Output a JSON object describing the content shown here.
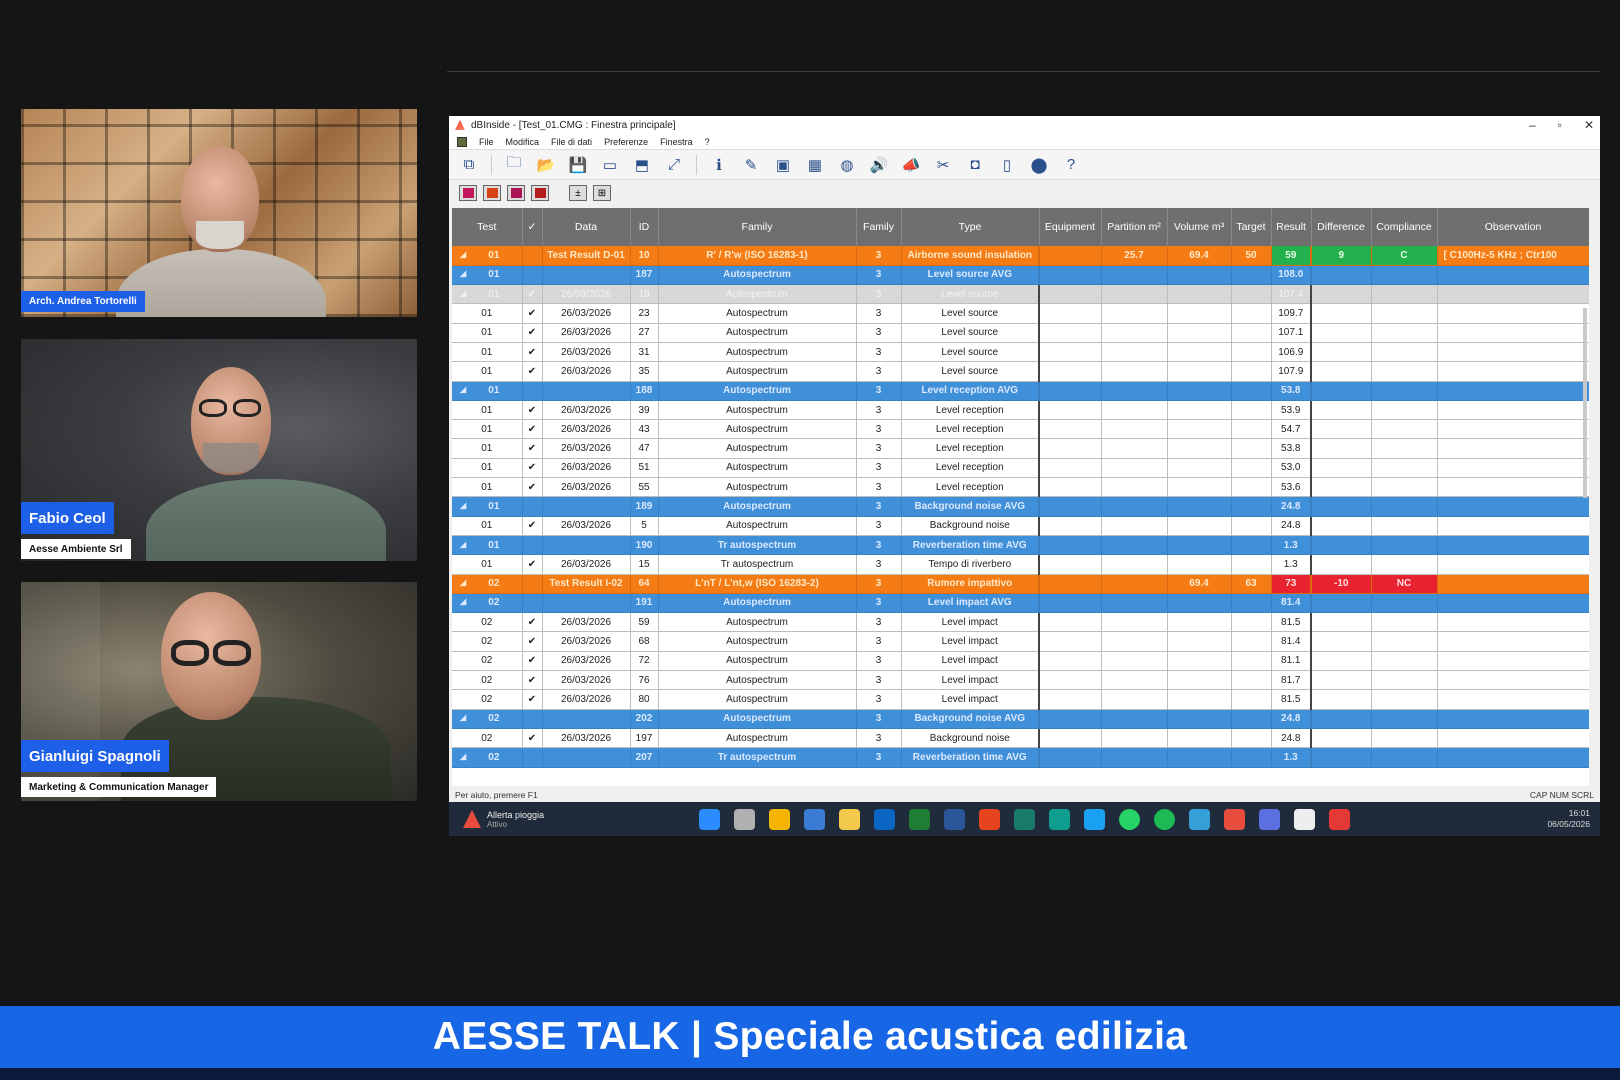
{
  "participants": [
    {
      "name": "Arch. Andrea Tortorelli",
      "subtitle": ""
    },
    {
      "name": "Fabio Ceol",
      "subtitle": "Aesse Ambiente Srl"
    },
    {
      "name": "Gianluigi Spagnoli",
      "subtitle": "Marketing & Communication Manager"
    }
  ],
  "app": {
    "title": "dBInside - [Test_01.CMG : Finestra principale]",
    "menu": [
      "File",
      "Modifica",
      "File di dati",
      "Preferenze",
      "Finestra",
      "?"
    ],
    "window_buttons": [
      "–",
      "▫",
      "✕"
    ],
    "toolbar_icons": [
      "copy-icon",
      "new-folder-icon",
      "open-folder-icon",
      "save-icon",
      "print-preview-icon",
      "tag-icon",
      "link-icon",
      "info-icon",
      "pencil-icon",
      "image-icon",
      "grid-icon",
      "globe-icon",
      "speaker-icon",
      "megaphone-icon",
      "scissors-icon",
      "camera-icon",
      "page-icon",
      "trash-icon",
      "help-icon"
    ],
    "toolbar_glyphs": [
      "⧉",
      "🗀",
      "📂",
      "💾",
      "▭",
      "⬒",
      "⤢",
      "ℹ",
      "✎",
      "▣",
      "▦",
      "◍",
      "🔊",
      "📣",
      "✂",
      "◘",
      "▯",
      "⬤",
      "?"
    ],
    "secondary_toolbar_colors": [
      "#c2185b",
      "#d84315",
      "#ad1457",
      "#b71c1c"
    ],
    "columns": [
      "Test",
      "✓",
      "Data",
      "ID",
      "Family",
      "Family",
      "Type",
      "Equipment",
      "Partition m²",
      "Volume m³",
      "Target",
      "Result",
      "Difference",
      "Compliance",
      "Observation"
    ],
    "rows": [
      {
        "kind": "orange",
        "expand": "◢",
        "test": "01",
        "check": "",
        "date": "Test Result D-01",
        "id": "10",
        "family": "R' / R'w (ISO 16283-1)",
        "fam": "3",
        "type": "Airborne sound insulation",
        "equipment": "",
        "partition": "25.7",
        "volume": "69.4",
        "target": "50",
        "result": "59",
        "difference": "9",
        "compliance": "C",
        "observation": "[ C100Hz-5 KHz ; Ctr100",
        "green": true
      },
      {
        "kind": "blue",
        "expand": "◢",
        "test": "01",
        "check": "",
        "date": "",
        "id": "187",
        "family": "Autospectrum",
        "fam": "3",
        "type": "Level source AVG",
        "result": "108.0"
      },
      {
        "kind": "gray",
        "expand": "◢",
        "test": "01",
        "check": "✔",
        "date": "26/03/2026",
        "id": "19",
        "family": "Autospectrum",
        "fam": "3",
        "type": "Level source",
        "result": "107.4"
      },
      {
        "kind": "white",
        "test": "01",
        "check": "✔",
        "date": "26/03/2026",
        "id": "23",
        "family": "Autospectrum",
        "fam": "3",
        "type": "Level source",
        "result": "109.7"
      },
      {
        "kind": "white",
        "test": "01",
        "check": "✔",
        "date": "26/03/2026",
        "id": "27",
        "family": "Autospectrum",
        "fam": "3",
        "type": "Level source",
        "result": "107.1"
      },
      {
        "kind": "white",
        "test": "01",
        "check": "✔",
        "date": "26/03/2026",
        "id": "31",
        "family": "Autospectrum",
        "fam": "3",
        "type": "Level source",
        "result": "106.9"
      },
      {
        "kind": "white",
        "test": "01",
        "check": "✔",
        "date": "26/03/2026",
        "id": "35",
        "family": "Autospectrum",
        "fam": "3",
        "type": "Level source",
        "result": "107.9"
      },
      {
        "kind": "blue",
        "expand": "◢",
        "test": "01",
        "check": "",
        "date": "",
        "id": "188",
        "family": "Autospectrum",
        "fam": "3",
        "type": "Level reception AVG",
        "result": "53.8"
      },
      {
        "kind": "white",
        "test": "01",
        "check": "✔",
        "date": "26/03/2026",
        "id": "39",
        "family": "Autospectrum",
        "fam": "3",
        "type": "Level reception",
        "result": "53.9"
      },
      {
        "kind": "white",
        "test": "01",
        "check": "✔",
        "date": "26/03/2026",
        "id": "43",
        "family": "Autospectrum",
        "fam": "3",
        "type": "Level reception",
        "result": "54.7"
      },
      {
        "kind": "white",
        "test": "01",
        "check": "✔",
        "date": "26/03/2026",
        "id": "47",
        "family": "Autospectrum",
        "fam": "3",
        "type": "Level reception",
        "result": "53.8"
      },
      {
        "kind": "white",
        "test": "01",
        "check": "✔",
        "date": "26/03/2026",
        "id": "51",
        "family": "Autospectrum",
        "fam": "3",
        "type": "Level reception",
        "result": "53.0"
      },
      {
        "kind": "white",
        "test": "01",
        "check": "✔",
        "date": "26/03/2026",
        "id": "55",
        "family": "Autospectrum",
        "fam": "3",
        "type": "Level reception",
        "result": "53.6"
      },
      {
        "kind": "blue",
        "expand": "◢",
        "test": "01",
        "check": "",
        "date": "",
        "id": "189",
        "family": "Autospectrum",
        "fam": "3",
        "type": "Background noise AVG",
        "result": "24.8"
      },
      {
        "kind": "white",
        "test": "01",
        "check": "✔",
        "date": "26/03/2026",
        "id": "5",
        "family": "Autospectrum",
        "fam": "3",
        "type": "Background noise",
        "result": "24.8"
      },
      {
        "kind": "blue",
        "expand": "◢",
        "test": "01",
        "check": "",
        "date": "",
        "id": "190",
        "family": "Tr autospectrum",
        "fam": "3",
        "type": "Reverberation time AVG",
        "result": "1.3"
      },
      {
        "kind": "white",
        "test": "01",
        "check": "✔",
        "date": "26/03/2026",
        "id": "15",
        "family": "Tr autospectrum",
        "fam": "3",
        "type": "Tempo di riverbero",
        "result": "1.3"
      },
      {
        "kind": "orange",
        "expand": "◢",
        "test": "02",
        "check": "",
        "date": "Test Result I-02",
        "id": "64",
        "family": "L'nT / L'nt,w (ISO 16283-2)",
        "fam": "3",
        "type": "Rumore impattivo",
        "equipment": "",
        "partition": "",
        "volume": "69.4",
        "target": "63",
        "result": "73",
        "difference": "-10",
        "compliance": "NC",
        "observation": "",
        "red": true
      },
      {
        "kind": "blue",
        "expand": "◢",
        "test": "02",
        "check": "",
        "date": "",
        "id": "191",
        "family": "Autospectrum",
        "fam": "3",
        "type": "Level impact AVG",
        "result": "81.4"
      },
      {
        "kind": "white",
        "test": "02",
        "check": "✔",
        "date": "26/03/2026",
        "id": "59",
        "family": "Autospectrum",
        "fam": "3",
        "type": "Level impact",
        "result": "81.5"
      },
      {
        "kind": "white",
        "test": "02",
        "check": "✔",
        "date": "26/03/2026",
        "id": "68",
        "family": "Autospectrum",
        "fam": "3",
        "type": "Level impact",
        "result": "81.4"
      },
      {
        "kind": "white",
        "test": "02",
        "check": "✔",
        "date": "26/03/2026",
        "id": "72",
        "family": "Autospectrum",
        "fam": "3",
        "type": "Level impact",
        "result": "81.1"
      },
      {
        "kind": "white",
        "test": "02",
        "check": "✔",
        "date": "26/03/2026",
        "id": "76",
        "family": "Autospectrum",
        "fam": "3",
        "type": "Level impact",
        "result": "81.7"
      },
      {
        "kind": "white",
        "test": "02",
        "check": "✔",
        "date": "26/03/2026",
        "id": "80",
        "family": "Autospectrum",
        "fam": "3",
        "type": "Level impact",
        "result": "81.5"
      },
      {
        "kind": "blue",
        "expand": "◢",
        "test": "02",
        "check": "",
        "date": "",
        "id": "202",
        "family": "Autospectrum",
        "fam": "3",
        "type": "Background noise AVG",
        "result": "24.8"
      },
      {
        "kind": "white",
        "test": "02",
        "check": "✔",
        "date": "26/03/2026",
        "id": "197",
        "family": "Autospectrum",
        "fam": "3",
        "type": "Background noise",
        "result": "24.8"
      },
      {
        "kind": "blue",
        "expand": "◢",
        "test": "02",
        "check": "",
        "date": "",
        "id": "207",
        "family": "Tr autospectrum",
        "fam": "3",
        "type": "Reverberation time AVG",
        "result": "1.3"
      }
    ],
    "status_left": "Per aiuto, premere F1",
    "status_right": "CAP  NUM  SCRL"
  },
  "taskbar": {
    "weather_title": "Allerta pioggia",
    "weather_sub": "Attivo",
    "icon_colors": [
      "#2b8cff",
      "#b0b0b0",
      "#f4b400",
      "#3a7bd5",
      "#f2c94c",
      "#0a66c2",
      "#1e7e34",
      "#2a5699",
      "#e8431f",
      "#1b7b6b",
      "#0f9d8f",
      "#1aa1f2",
      "#25d366",
      "#1db954",
      "#35a0d8",
      "#e74c3c",
      "#5b6fe0",
      "#eeeeee",
      "#e53935"
    ],
    "icon_names": [
      "windows-start-icon",
      "file-explorer-icon",
      "chrome-icon",
      "calculator-icon",
      "folder-icon",
      "outlook-icon",
      "excel-icon",
      "word-icon",
      "pdf-icon",
      "publisher-icon",
      "camera-app-icon",
      "snipping-icon",
      "whatsapp-icon",
      "spotify-icon",
      "edge-icon",
      "meet-icon",
      "firefox-icon",
      "notepad-icon",
      "dbinside-icon"
    ],
    "time": "16:01",
    "date": "06/05/2026"
  },
  "banner": "AESSE TALK | Speciale acustica edilizia"
}
